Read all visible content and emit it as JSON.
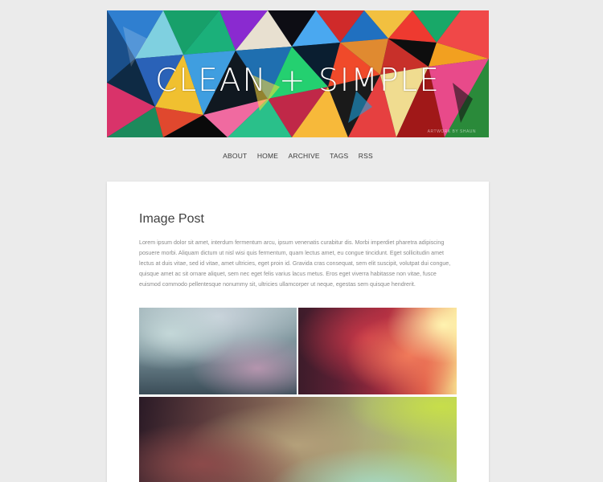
{
  "header": {
    "title": "CLEAN + SIMPLE",
    "credit": "ARTWORK BY SHAUN"
  },
  "nav": {
    "items": [
      {
        "label": "ABOUT"
      },
      {
        "label": "HOME"
      },
      {
        "label": "ARCHIVE"
      },
      {
        "label": "TAGS"
      },
      {
        "label": "RSS"
      }
    ]
  },
  "post": {
    "title": "Image Post",
    "body": "Lorem ipsum dolor sit amet, interdum fermentum arcu, ipsum venenatis curabitur dis. Morbi imperdiet pharetra adipiscing posuere morbi. Aliquam dictum ut nisl wisi quis fermentum, quam lectus amet, eu congue tincidunt. Eget sollicitudin amet lectus at duis vitae, sed id vitae, amet ultricies, eget proin id. Gravida cras consequat, sem elit suscipit, volutpat dui congue, quisque amet ac sit ornare aliquet, sem nec eget felis varius lacus metus. Eros eget viverra habitasse non vitae, fusce euismod commodo pellentesque nonummy sit, ultricies ullamcorper ut neque, egestas sem quisque hendrerit."
  },
  "colors": {
    "background": "#ebebeb",
    "card": "#ffffff",
    "title": "#3f3f3f",
    "body_text": "#8a8a8a",
    "nav_text": "#3a3a3a"
  }
}
